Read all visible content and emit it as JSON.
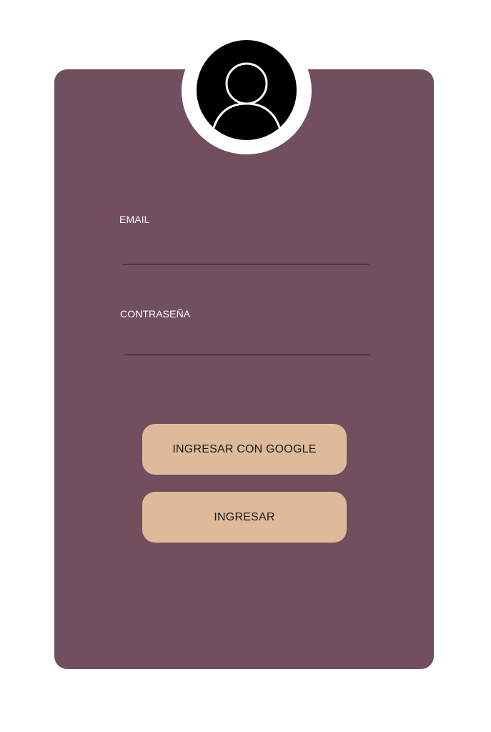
{
  "colors": {
    "card_background": "#724F5E",
    "avatar_background": "#000000",
    "avatar_ring": "#FFFFFF",
    "button_background": "#DEBA9B",
    "label_text": "#FFFFFF",
    "underline": "#1F1A1C"
  },
  "avatar": {
    "icon": "user-profile-icon"
  },
  "form": {
    "email": {
      "label": "EMAIL",
      "value": ""
    },
    "password": {
      "label": "CONTRASEÑA",
      "value": ""
    }
  },
  "buttons": {
    "google_label": "INGRESAR CON GOOGLE",
    "login_label": "INGRESAR"
  }
}
